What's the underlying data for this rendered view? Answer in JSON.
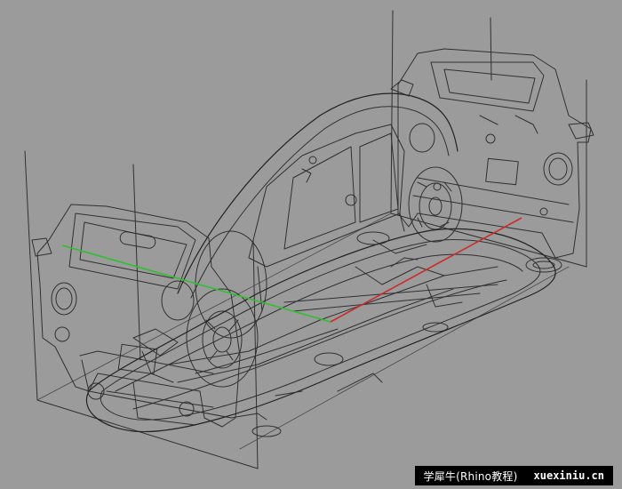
{
  "viewport": {
    "background": "#9b9b9b",
    "wire_color": "#303030",
    "axis": {
      "x_color": "#cc2b2b",
      "y_color": "#2fbf2f"
    }
  },
  "watermark": {
    "brand": "学犀牛(Rhino教程)",
    "site": "xuexiniu.cn"
  }
}
